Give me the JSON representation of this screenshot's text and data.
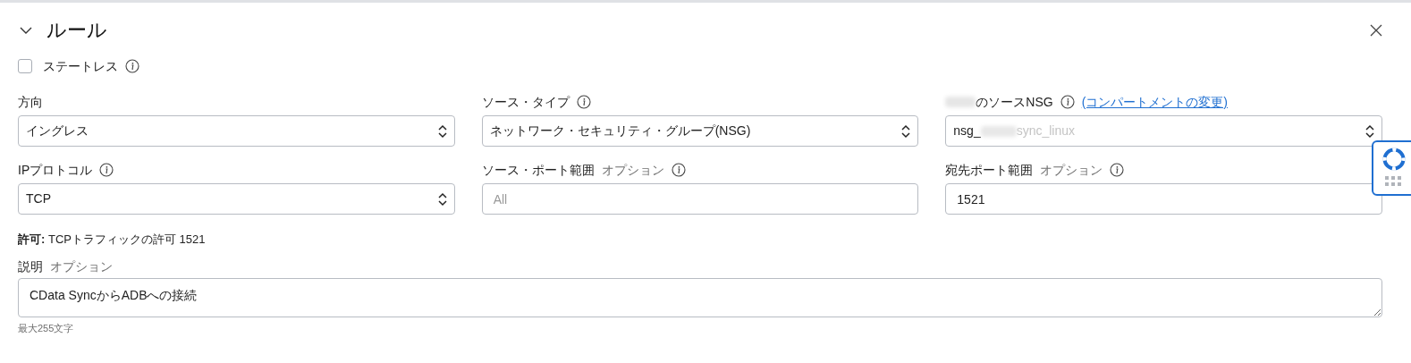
{
  "title": "ルール",
  "expanded": true,
  "stateless": {
    "label": "ステートレス",
    "checked": false
  },
  "fields": [
    {
      "kind": "select",
      "label": "方向",
      "value": "イングレス",
      "info": false
    },
    {
      "kind": "select",
      "label": "ソース・タイプ",
      "value": "ネットワーク・セキュリティ・グループ(NSG)",
      "info": true
    },
    {
      "kind": "redacted-select",
      "label": "のソースNSG",
      "link": "(コンパートメントの変更)",
      "value_start": "nsg_",
      "value_end": "sync_linux",
      "info": true
    },
    {
      "kind": "select",
      "label": "IPプロトコル",
      "value": "TCP",
      "info": true
    },
    {
      "kind": "input",
      "label": "ソース・ポート範囲",
      "optional": "オプション",
      "placeholder": "All",
      "info": true
    },
    {
      "kind": "input",
      "label": "宛先ポート範囲",
      "optional": "オプション",
      "value": "1521",
      "info": true
    }
  ],
  "summary": {
    "label": "許可:",
    "text": "TCPトラフィックの許可 1521"
  },
  "description": {
    "label": "説明",
    "optional": "オプション",
    "value": "CData SyncからADBへの接続",
    "hint": "最大255文字"
  }
}
